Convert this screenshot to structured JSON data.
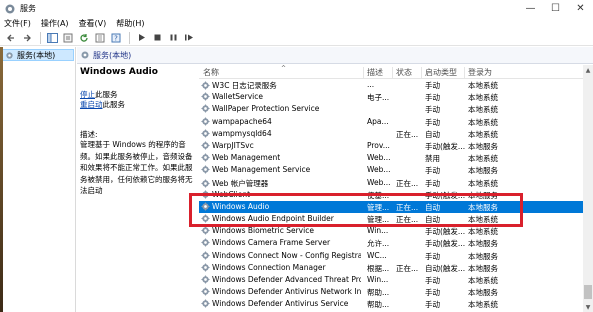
{
  "window": {
    "title": "服务",
    "minimize": "—",
    "maximize": "☐",
    "close": "✕"
  },
  "menu": [
    "文件(F)",
    "操作(A)",
    "查看(V)",
    "帮助(H)"
  ],
  "tree": {
    "item": "服务(本地)"
  },
  "main_header": {
    "label": "服务(本地)"
  },
  "description": {
    "title": "Windows Audio",
    "stop_link": "停止",
    "stop_suffix": "此服务",
    "restart_link": "重启动",
    "restart_suffix": "此服务",
    "label": "描述:",
    "body": "管理基于 Windows 的程序的音频。如果此服务被停止，音频设备和效果将不能正常工作。如果此服务被禁用，任何依赖它的服务将无法启动"
  },
  "table": {
    "columns": [
      "名称",
      "描述",
      "状态",
      "启动类型",
      "登录为"
    ],
    "rows": [
      {
        "name": "W3C 日志记录服务",
        "desc": "...",
        "status": "",
        "start": "手动",
        "logon": "本地系统"
      },
      {
        "name": "WalletService",
        "desc": "电子...",
        "status": "",
        "start": "手动",
        "logon": "本地系统"
      },
      {
        "name": "WallPaper Protection Service",
        "desc": "",
        "status": "",
        "start": "手动",
        "logon": "本地系统"
      },
      {
        "name": "wampapache64",
        "desc": "Apa...",
        "status": "",
        "start": "手动",
        "logon": "本地系统"
      },
      {
        "name": "wampmysqld64",
        "desc": "",
        "status": "正在...",
        "start": "自动",
        "logon": "本地系统"
      },
      {
        "name": "WarpJITSvc",
        "desc": "Prov...",
        "status": "",
        "start": "手动(触发...",
        "logon": "本地服务"
      },
      {
        "name": "Web Management",
        "desc": "Web...",
        "status": "",
        "start": "禁用",
        "logon": "本地系统"
      },
      {
        "name": "Web Management Service",
        "desc": "Web...",
        "status": "",
        "start": "手动",
        "logon": "本地服务"
      },
      {
        "name": "Web 帐户管理器",
        "desc": "Web...",
        "status": "正在...",
        "start": "手动",
        "logon": "本地系统"
      },
      {
        "name": "WebClient",
        "desc": "使基...",
        "status": "",
        "start": "手动(触发...",
        "logon": "本地服务"
      },
      {
        "name": "Windows Audio",
        "desc": "管理...",
        "status": "正在...",
        "start": "自动",
        "logon": "本地服务",
        "selected": true
      },
      {
        "name": "Windows Audio Endpoint Builder",
        "desc": "管理...",
        "status": "正在...",
        "start": "自动",
        "logon": "本地系统"
      },
      {
        "name": "Windows Biometric Service",
        "desc": "Win...",
        "status": "",
        "start": "手动(触发...",
        "logon": "本地系统"
      },
      {
        "name": "Windows Camera Frame Server",
        "desc": "允许...",
        "status": "",
        "start": "手动(触发...",
        "logon": "本地服务"
      },
      {
        "name": "Windows Connect Now - Config Registrar",
        "desc": "WC...",
        "status": "",
        "start": "手动",
        "logon": "本地服务"
      },
      {
        "name": "Windows Connection Manager",
        "desc": "根据...",
        "status": "正在...",
        "start": "自动(触发...",
        "logon": "本地服务"
      },
      {
        "name": "Windows Defender Advanced Threat Prot...",
        "desc": "Win...",
        "status": "",
        "start": "手动",
        "logon": "本地系统"
      },
      {
        "name": "Windows Defender Antivirus Network Ins...",
        "desc": "帮助...",
        "status": "",
        "start": "手动",
        "logon": "本地服务"
      },
      {
        "name": "Windows Defender Antivirus Service",
        "desc": "帮助...",
        "status": "",
        "start": "手动",
        "logon": "本地系统"
      }
    ]
  },
  "colors": {
    "selected_row": "#0078d7",
    "highlight_box": "#d9202c",
    "link": "#0645ad"
  }
}
